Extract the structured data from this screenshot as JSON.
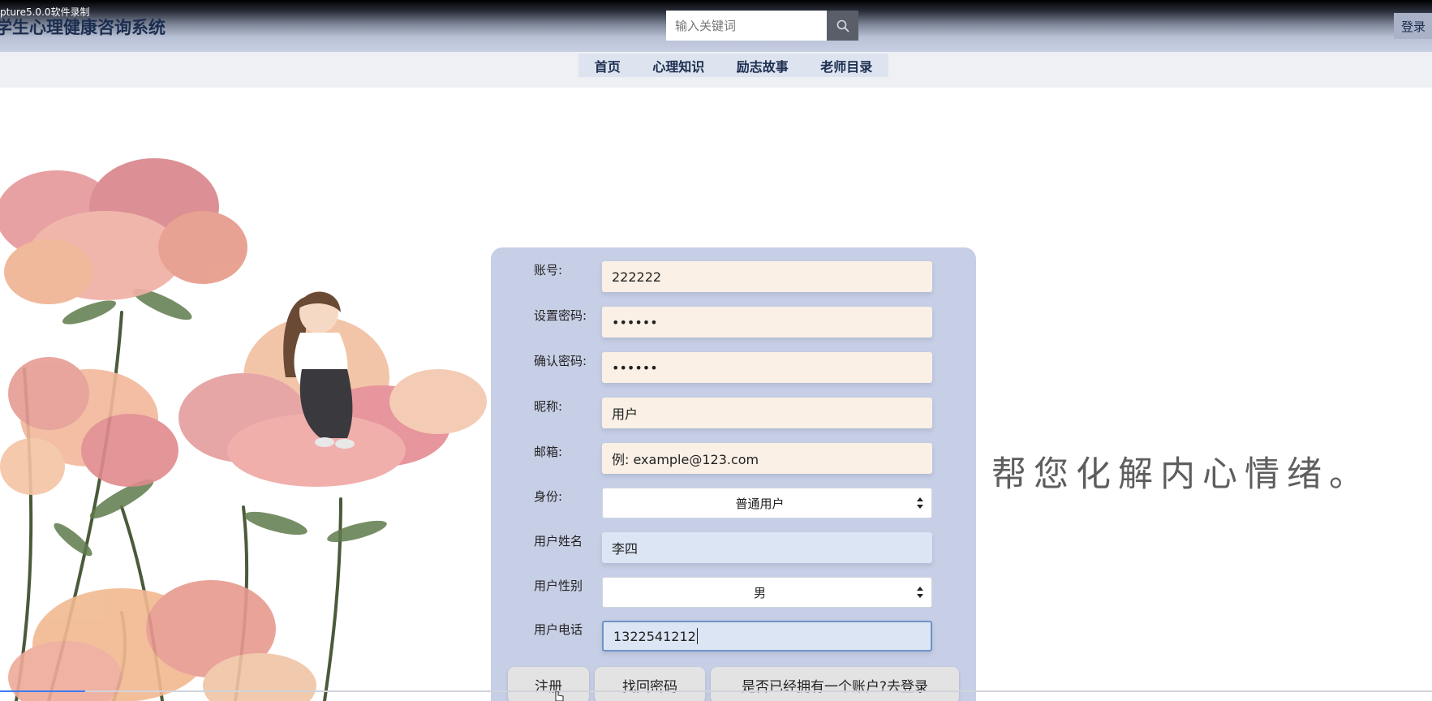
{
  "recording_label": "pture5.0.0软件录制",
  "header": {
    "site_title": "学生心理健康咨询系统",
    "search": {
      "placeholder": "输入关键词",
      "icon": "search-icon"
    },
    "login_label": "登录"
  },
  "nav": {
    "items": [
      {
        "label": "首页"
      },
      {
        "label": "心理知识"
      },
      {
        "label": "励志故事"
      },
      {
        "label": "老师目录"
      }
    ]
  },
  "slogan": "帮您化解内心情绪。",
  "form": {
    "fields": [
      {
        "label": "账号:",
        "value": "222222",
        "type": "text"
      },
      {
        "label": "设置密码:",
        "value": "••••••",
        "type": "password"
      },
      {
        "label": "确认密码:",
        "value": "••••••",
        "type": "password"
      },
      {
        "label": "昵称:",
        "value": "用户",
        "type": "text"
      },
      {
        "label": "邮箱:",
        "value": "例: example@123.com",
        "type": "text"
      },
      {
        "label": "身份:",
        "value": "普通用户",
        "type": "select"
      },
      {
        "label": "用户姓名",
        "value": "李四",
        "type": "text"
      },
      {
        "label": "用户性别",
        "value": "男",
        "type": "select"
      },
      {
        "label": "用户电话",
        "value": "1322541212",
        "type": "text"
      }
    ],
    "buttons": {
      "register": "注册",
      "recover": "找回密码",
      "to_login": "是否已经拥有一个账户?去登录"
    }
  },
  "colors": {
    "form_panel": "#c7cfe6",
    "input_bg": "#faf0e6",
    "input_active": "#dce5f4",
    "nav_text": "#1b2d4f"
  }
}
